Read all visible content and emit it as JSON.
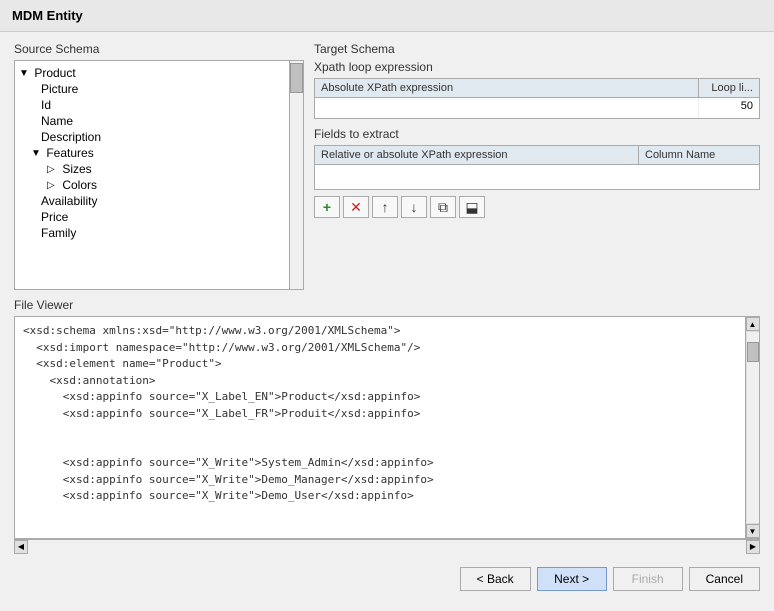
{
  "title": "MDM Entity",
  "source_schema": {
    "label": "Source Schema",
    "tree": [
      {
        "id": "product",
        "label": "Product",
        "level": 0,
        "expandable": true,
        "expanded": true
      },
      {
        "id": "picture",
        "label": "Picture",
        "level": 1,
        "expandable": false
      },
      {
        "id": "id",
        "label": "Id",
        "level": 1,
        "expandable": false
      },
      {
        "id": "name",
        "label": "Name",
        "level": 1,
        "expandable": false
      },
      {
        "id": "description",
        "label": "Description",
        "level": 1,
        "expandable": false
      },
      {
        "id": "features",
        "label": "Features",
        "level": 1,
        "expandable": true,
        "expanded": true
      },
      {
        "id": "sizes",
        "label": "Sizes",
        "level": 2,
        "expandable": true,
        "expanded": false
      },
      {
        "id": "colors",
        "label": "Colors",
        "level": 2,
        "expandable": true,
        "expanded": false
      },
      {
        "id": "availability",
        "label": "Availability",
        "level": 1,
        "expandable": false
      },
      {
        "id": "price",
        "label": "Price",
        "level": 1,
        "expandable": false
      },
      {
        "id": "family",
        "label": "Family",
        "level": 1,
        "expandable": false
      }
    ]
  },
  "target_schema": {
    "label": "Target Schema",
    "xpath_loop": {
      "title": "Xpath loop expression",
      "columns": [
        {
          "id": "abs_xpath",
          "label": "Absolute XPath expression"
        },
        {
          "id": "loop_li",
          "label": "Loop li..."
        }
      ],
      "rows": [
        {
          "abs_xpath": "",
          "loop_li": "50"
        }
      ]
    },
    "fields": {
      "title": "Fields to extract",
      "columns": [
        {
          "id": "rel_xpath",
          "label": "Relative or absolute XPath expression"
        },
        {
          "id": "col_name",
          "label": "Column Name"
        }
      ],
      "rows": []
    },
    "toolbar": {
      "add": "+",
      "delete": "✕",
      "up": "↑",
      "down": "↓",
      "copy": "⧉",
      "paste": "⬓"
    }
  },
  "file_viewer": {
    "label": "File Viewer",
    "content": "<xsd:schema xmlns:xsd=\"http://www.w3.org/2001/XMLSchema\">\n  <xsd:import namespace=\"http://www.w3.org/2001/XMLSchema\"/>\n  <xsd:element name=\"Product\">\n    <xsd:annotation>\n      <xsd:appinfo source=\"X_Label_EN\">Product</xsd:appinfo>\n      <xsd:appinfo source=\"X_Label_FR\">Produit</xsd:appinfo>\n\n\n      <xsd:appinfo source=\"X_Write\">System_Admin</xsd:appinfo>\n      <xsd:appinfo source=\"X_Write\">Demo_Manager</xsd:appinfo>\n      <xsd:appinfo source=\"X_Write\">Demo_User</xsd:appinfo>"
  },
  "buttons": {
    "back": "< Back",
    "next": "Next >",
    "finish": "Finish",
    "cancel": "Cancel"
  }
}
